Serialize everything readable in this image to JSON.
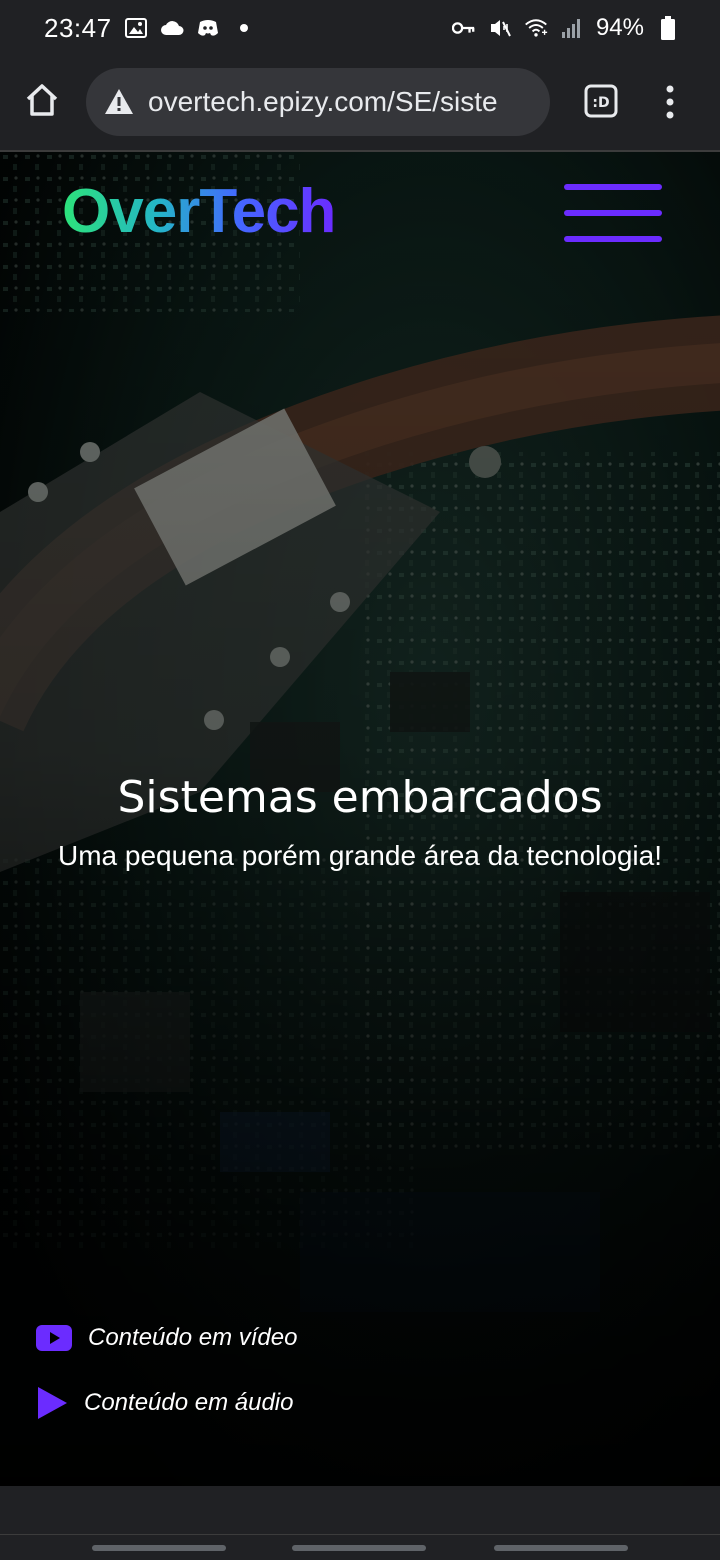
{
  "status_bar": {
    "time": "23:47",
    "battery": "94%",
    "icons": [
      "image-icon",
      "cloud-icon",
      "discord-icon",
      "dot-icon",
      "key-icon",
      "mute-vibrate-icon",
      "wifi-icon",
      "signal-icon",
      "battery-icon"
    ]
  },
  "browser": {
    "url": "overtech.epizy.com/SE/siste",
    "security": "not-secure-warning-icon",
    "colors": {
      "toolbar": "#202124",
      "url_box": "#35363a"
    }
  },
  "site": {
    "logo": "OverTech",
    "hero_title": "Sistemas embarcados",
    "hero_subtitle": "Uma pequena porém grande área da tecnologia!",
    "links": [
      {
        "label": "Conteúdo em vídeo",
        "icon": "youtube-icon"
      },
      {
        "label": "Conteúdo em áudio",
        "icon": "play-icon"
      }
    ],
    "colors": {
      "accent": "#6b2cff",
      "logo_gradient": [
        "#2de37a",
        "#24b5c7",
        "#4467ff",
        "#6b2cff"
      ]
    }
  }
}
